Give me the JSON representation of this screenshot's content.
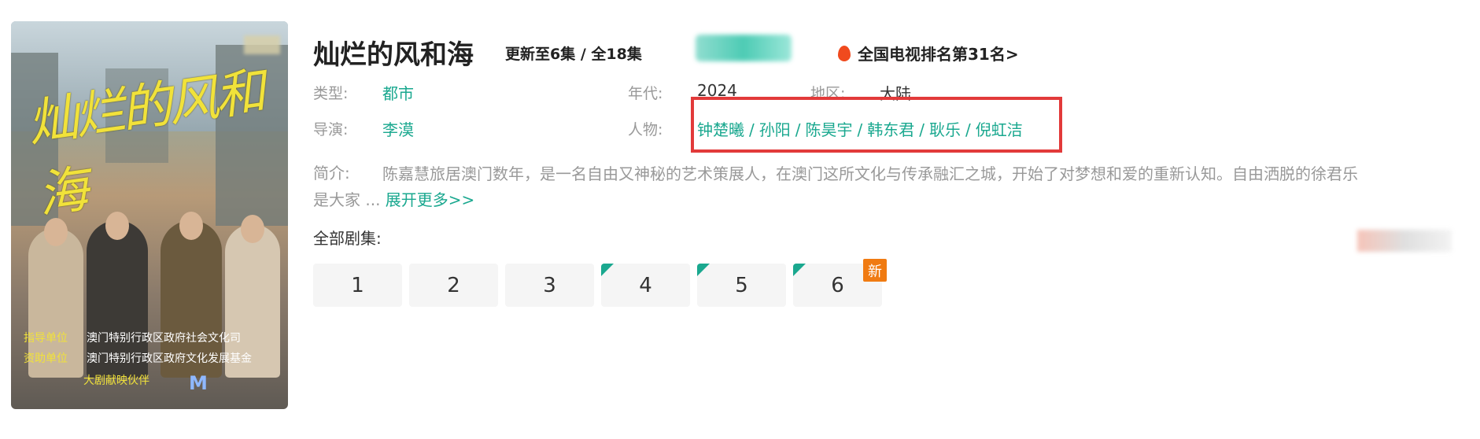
{
  "poster": {
    "title_art": "灿烂的风和海",
    "credits": [
      {
        "k": "指导单位",
        "v": "澳门特别行政区政府社会文化司"
      },
      {
        "k": "资助单位",
        "v": "澳门特别行政区政府文化发展基金"
      }
    ],
    "credit3": "大剧献映伙伴",
    "logo": "M"
  },
  "show": {
    "title": "灿烂的风和海",
    "update": "更新至6集 / 全18集",
    "rank": "全国电视排名第31名>"
  },
  "meta": {
    "genre_label": "类型:",
    "genre": "都市",
    "year_label": "年代:",
    "year": "2024",
    "region_label": "地区:",
    "region": "大陆",
    "director_label": "导演:",
    "director": "李漠",
    "people_label": "人物:",
    "people": [
      "钟楚曦",
      "孙阳",
      "陈昊宇",
      "韩东君",
      "耿乐",
      "倪虹洁"
    ]
  },
  "intro": {
    "label": "简介:",
    "line1": "陈嘉慧旅居澳门数年，是一名自由又神秘的艺术策展人，在澳门这所文化与传承融汇之城，开始了对梦想和爱的重新认知。自由洒脱的徐君乐",
    "line2": "是大家 ...",
    "more": "展开更多>>"
  },
  "episodes": {
    "label": "全部剧集:",
    "items": [
      "1",
      "2",
      "3",
      "4",
      "5",
      "6"
    ],
    "new_badge": "新"
  },
  "colors": {
    "accent": "#1aa88f",
    "highlight_box": "#e23a3a",
    "new_badge": "#f07b12"
  }
}
